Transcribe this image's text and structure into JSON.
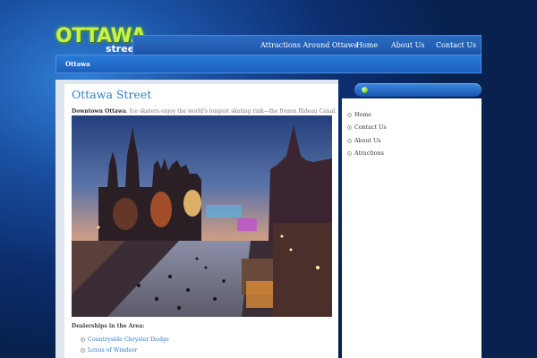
{
  "logo": {
    "main": "OTTAWA",
    "sub": "street"
  },
  "nav": {
    "items": [
      {
        "label": "Attractions Around Ottawa"
      },
      {
        "label": "Home"
      },
      {
        "label": "About Us"
      },
      {
        "label": "Contact Us"
      }
    ]
  },
  "breadcrumb": {
    "current": "Ottawa"
  },
  "post": {
    "title": "Ottawa Street",
    "intro_bold": "Downtown Ottawa",
    "intro_text": ". Ice skaters enjoy the world's longest skating rink—the frozen Rideau Canal.",
    "dealers_heading": "Dealerships in the Area:",
    "dealers": [
      {
        "label": "Countryside Chrysler Dodge"
      },
      {
        "label": "Lexus of Windsor"
      }
    ]
  },
  "sidebar": {
    "links": [
      {
        "label": "Home"
      },
      {
        "label": "Contact Us"
      },
      {
        "label": "About Us"
      },
      {
        "label": "Atractions"
      }
    ]
  },
  "colors": {
    "background": "#0c2d6e",
    "logo_green": "#c6f04a",
    "link_blue": "#2d7fc8",
    "nav_blue": "#1e55a8"
  }
}
